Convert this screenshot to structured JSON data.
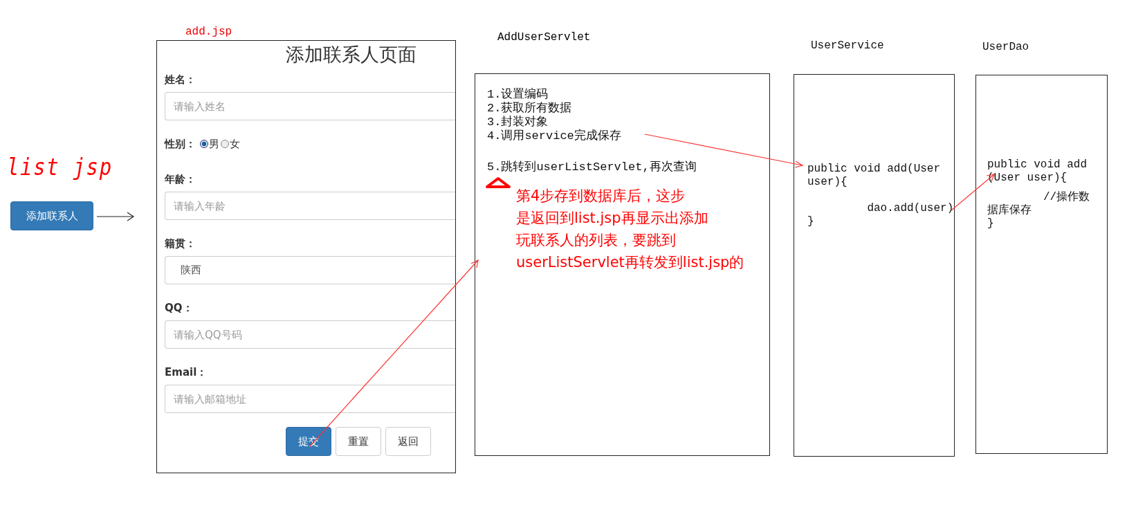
{
  "list_page": {
    "heading": "list jsp",
    "button": "添加联系人"
  },
  "add_page": {
    "file_label": "add.jsp",
    "title": "添加联系人页面",
    "fields": [
      {
        "kind": "text",
        "label": "姓名：",
        "placeholder": "请输入姓名"
      },
      {
        "kind": "radio",
        "label": "性别：",
        "options": [
          {
            "label": "男",
            "selected": true
          },
          {
            "label": "女",
            "selected": false
          }
        ]
      },
      {
        "kind": "text",
        "label": "年龄：",
        "placeholder": "请输入年龄"
      },
      {
        "kind": "text",
        "label": "籍贯：",
        "value": "陕西"
      },
      {
        "kind": "text",
        "label": "QQ：",
        "placeholder": "请输入QQ号码"
      },
      {
        "kind": "text",
        "label": "Email：",
        "placeholder": "请输入邮箱地址"
      }
    ],
    "buttons": [
      {
        "label": "提交",
        "kind": "primary"
      },
      {
        "label": "重置",
        "kind": "default"
      },
      {
        "label": "返回",
        "kind": "default"
      }
    ]
  },
  "servlet": {
    "title": "AddUserServlet",
    "steps": [
      "1.设置编码",
      "2.获取所有数据",
      "3.封装对象",
      "4.调用service完成保存"
    ],
    "last_step": "5.跳转到userListServlet,再次查询",
    "note_lines": [
      "第4步存到数据库后，这步",
      "是返回到list.jsp再显示出添加",
      "玩联系人的列表，要跳到",
      "userListServlet再转发到list.jsp的"
    ]
  },
  "service": {
    "title": "UserService",
    "code": "public void add(User\nuser){\n\n         dao.add(user)\n}"
  },
  "dao": {
    "title": "UserDao",
    "code": "public void add\n(User user){",
    "comment": "//操作数据库保存",
    "code_end": "}"
  }
}
